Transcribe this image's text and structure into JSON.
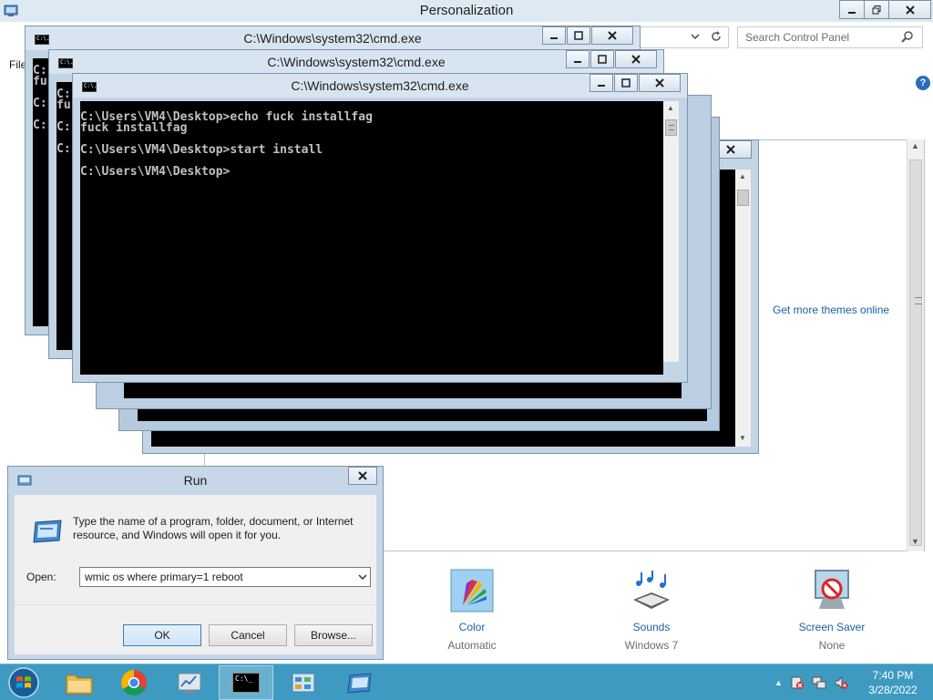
{
  "control_panel": {
    "title": "Personalization",
    "search_placeholder": "Search Control Panel",
    "file_menu": "File",
    "help": "?",
    "get_more_themes": "Get more themes online",
    "bottom_items": [
      {
        "label": "Color",
        "sub": "Automatic",
        "icon": "color-palette-icon"
      },
      {
        "label": "Sounds",
        "sub": "Windows 7",
        "icon": "sounds-icon"
      },
      {
        "label": "Screen Saver",
        "sub": "None",
        "icon": "screen-saver-icon"
      }
    ]
  },
  "cmd_windows": [
    {
      "title": "C:\\Windows\\system32\\cmd.exe",
      "icon_label": "C:\\."
    },
    {
      "title": "C:\\Windows\\system32\\cmd.exe",
      "icon_label": "C:\\."
    },
    {
      "title": "C:\\Windows\\system32\\cmd.exe",
      "icon_label": "C:\\."
    }
  ],
  "cmd_back_fragments": {
    "win1": [
      "C:",
      "fu",
      "C:",
      "C:"
    ],
    "win2": [
      "C:",
      "fu",
      "C:",
      "C:"
    ]
  },
  "cmd_front_text": "C:\\Users\\VM4\\Desktop>echo fuck installfag\nfuck installfag\n\nC:\\Users\\VM4\\Desktop>start install\n\nC:\\Users\\VM4\\Desktop>",
  "run_dialog": {
    "title": "Run",
    "message": "Type the name of a program, folder, document, or Internet resource, and Windows will open it for you.",
    "open_label": "Open:",
    "open_value": "wmic os where primary=1 reboot",
    "ok_label": "OK",
    "cancel_label": "Cancel",
    "browse_label": "Browse..."
  },
  "taskbar": {
    "time": "7:40 PM",
    "date": "3/28/2022",
    "cmd_button_label": "C:\\_"
  },
  "colors": {
    "taskbar": "#3e9ac0",
    "link": "#1c5fa8",
    "console_bg": "#000000",
    "console_text": "#c0c0c0"
  }
}
